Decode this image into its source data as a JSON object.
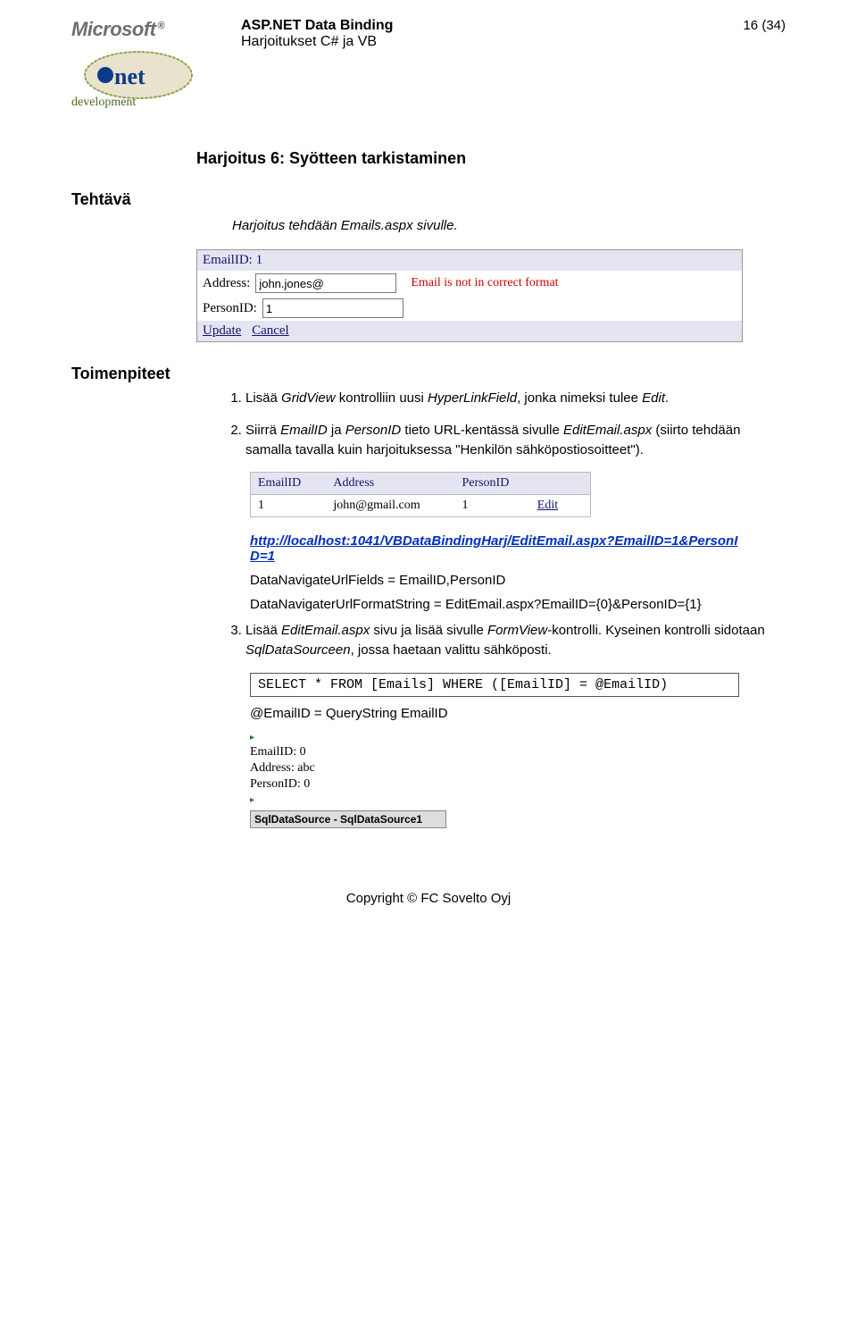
{
  "header": {
    "brand": "Microsoft",
    "reg": "®",
    "doc_title": "ASP.NET Data Binding",
    "doc_sub": "Harjoitukset C# ja VB",
    "page_no": "16 (34)"
  },
  "exercise_title": "Harjoitus 6: Syötteen tarkistaminen",
  "task_label": "Tehtävä",
  "task_note": "Harjoitus tehdään Emails.aspx sivulle.",
  "formshot": {
    "emailid_label": "EmailID: 1",
    "address_label": "Address:",
    "address_value": "john.jones@",
    "address_error": "Email is not in correct format",
    "personid_label": "PersonID:",
    "personid_value": "1",
    "update": "Update",
    "cancel": "Cancel"
  },
  "steps_label": "Toimenpiteet",
  "step1_a": "Lisää ",
  "step1_b": "GridView",
  "step1_c": " kontrolliin uusi ",
  "step1_d": "HyperLinkField",
  "step1_e": ", jonka nimeksi tulee ",
  "step1_f": "Edit",
  "step1_g": ".",
  "step2_a": "Siirrä ",
  "step2_b": "EmailID",
  "step2_c": " ja ",
  "step2_d": "PersonID",
  "step2_e": " tieto URL-kentässä sivulle ",
  "step2_f": "EditEmail.aspx",
  "step2_g": " (siirto tehdään samalla tavalla kuin harjoituksessa \"Henkilön sähköpostiosoitteet\").",
  "grid": {
    "h1": "EmailID",
    "h2": "Address",
    "h3": "PersonID",
    "r1c1": "1",
    "r1c2": "john@gmail.com",
    "r1c3": "1",
    "edit": "Edit"
  },
  "url_line1": "http://localhost:1041/VBDataBindingHarj/EditEmail.aspx?EmailID=1&PersonI",
  "url_line2": "D=1",
  "nav_fields": "DataNavigateUrlFields = EmailID,PersonID",
  "nav_format": "DataNavigaterUrlFormatString = EditEmail.aspx?EmailID={0}&PersonID={1}",
  "step3_a": "Lisää ",
  "step3_b": "EditEmail.aspx",
  "step3_c": " sivu ja lisää sivulle ",
  "step3_d": "FormView",
  "step3_e": "-kontrolli. Kyseinen kontrolli sidotaan ",
  "step3_f": "SqlDataSourceen",
  "step3_g": ", jossa haetaan valittu sähköposti.",
  "sql": "SELECT * FROM [Emails] WHERE ([EmailID] = @EmailID)",
  "querystring": "@EmailID = QueryString EmailID",
  "fv": {
    "r1": "EmailID: 0",
    "r2": "Address: abc",
    "r3": "PersonID: 0",
    "ds": "SqlDataSource - SqlDataSource1"
  },
  "footer": "Copyright ©  FC Sovelto Oyj"
}
